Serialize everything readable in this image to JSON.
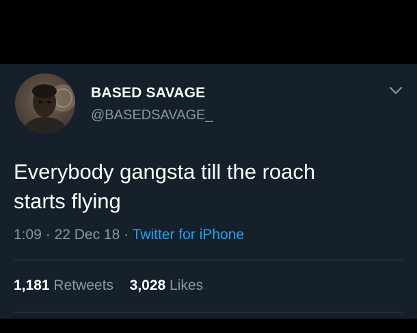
{
  "author": {
    "display_name": "BASED SAVAGE",
    "handle": "@BASEDSAVAGE_",
    "avatar_icon": "profile-photo"
  },
  "tweet": {
    "text_line1": "Everybody gangsta till the roach",
    "text_line2": "starts flying",
    "time": "1:09",
    "date": "22 Dec 18",
    "separator": "·",
    "source": "Twitter for iPhone"
  },
  "stats": {
    "retweets_count": "1,181",
    "retweets_label": "Retweets",
    "likes_count": "3,028",
    "likes_label": "Likes"
  },
  "icons": {
    "more_menu": "chevron-down-icon"
  },
  "colors": {
    "background": "#15202b",
    "text_primary": "#ffffff",
    "text_secondary": "#8899a6",
    "link": "#1da1f2",
    "divider": "#38444d"
  }
}
